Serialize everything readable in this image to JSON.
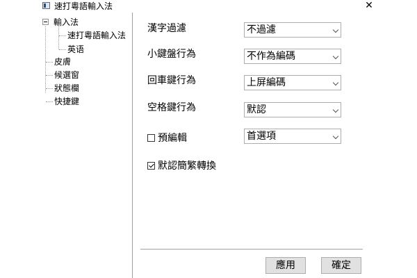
{
  "window": {
    "title": "速打粵語輸入法",
    "app_icon": "app-icon",
    "close_glyph": "✕"
  },
  "tree": {
    "root": {
      "label": "輸入法",
      "expanded": true
    },
    "children": [
      "速打粵語輸入法",
      "英语"
    ],
    "siblings": [
      "皮膚",
      "候選窗",
      "狀態欄",
      "快捷鍵"
    ]
  },
  "settings": {
    "han_filter": {
      "label": "漢字過濾",
      "value": "不過濾"
    },
    "keypad_behavior": {
      "label": "小鍵盤行為",
      "value": "不作為編碼"
    },
    "enter_behavior": {
      "label": "回車鍵行為",
      "value": "上屏編碼"
    },
    "space_behavior": {
      "label": "空格鍵行為",
      "value": "默認"
    },
    "pre_edit": {
      "checkbox_label": "預編輯",
      "checked": false,
      "value": "首選項"
    },
    "simp_trad_convert": {
      "checkbox_label": "默認簡繁轉換",
      "checked": true
    }
  },
  "buttons": {
    "apply": "應用",
    "ok": "確定"
  }
}
